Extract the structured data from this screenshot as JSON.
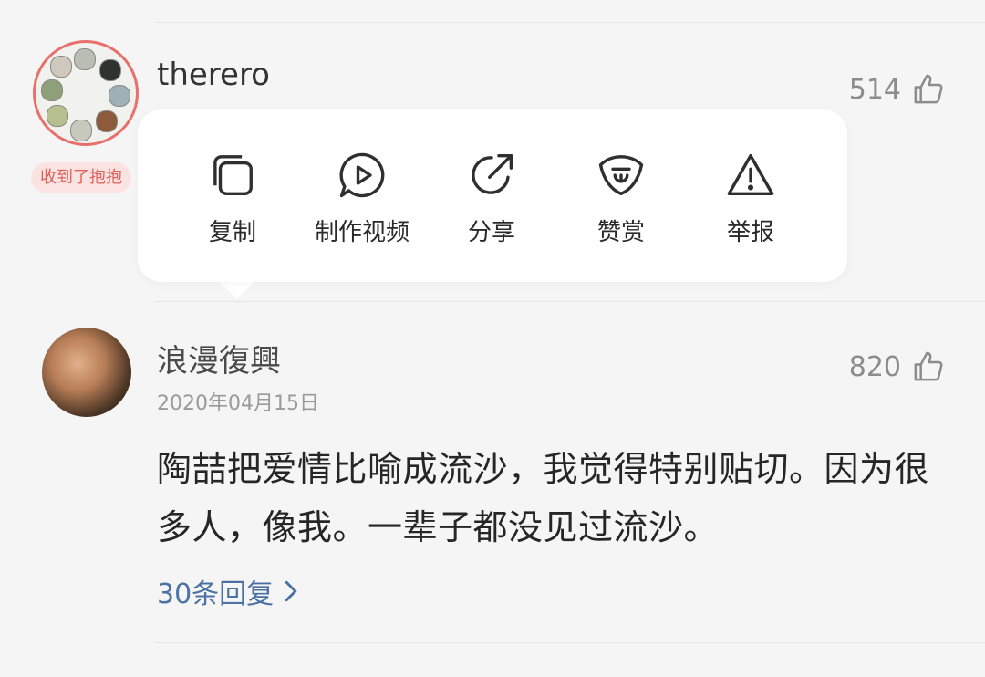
{
  "comments": [
    {
      "username": "therero",
      "badge": "收到了抱抱",
      "likes": "514"
    },
    {
      "username": "浪漫復興",
      "date": "2020年04月15日",
      "likes": "820",
      "text": "陶喆把爱情比喻成流沙，我觉得特别贴切。因为很多人，像我。一辈子都没见过流沙。",
      "replies_label": "30条回复"
    }
  ],
  "popup_menu": {
    "actions": [
      {
        "label": "复制",
        "icon": "copy-icon"
      },
      {
        "label": "制作视频",
        "icon": "make-video-icon"
      },
      {
        "label": "分享",
        "icon": "share-icon"
      },
      {
        "label": "赞赏",
        "icon": "tip-icon"
      },
      {
        "label": "举报",
        "icon": "report-icon"
      }
    ]
  },
  "colors": {
    "background": "#f5f5f5",
    "reply_link": "#4b72a2",
    "badge_text": "#e0605a",
    "badge_bg": "#fbe3e2",
    "avatar_ring": "#e8706c"
  }
}
